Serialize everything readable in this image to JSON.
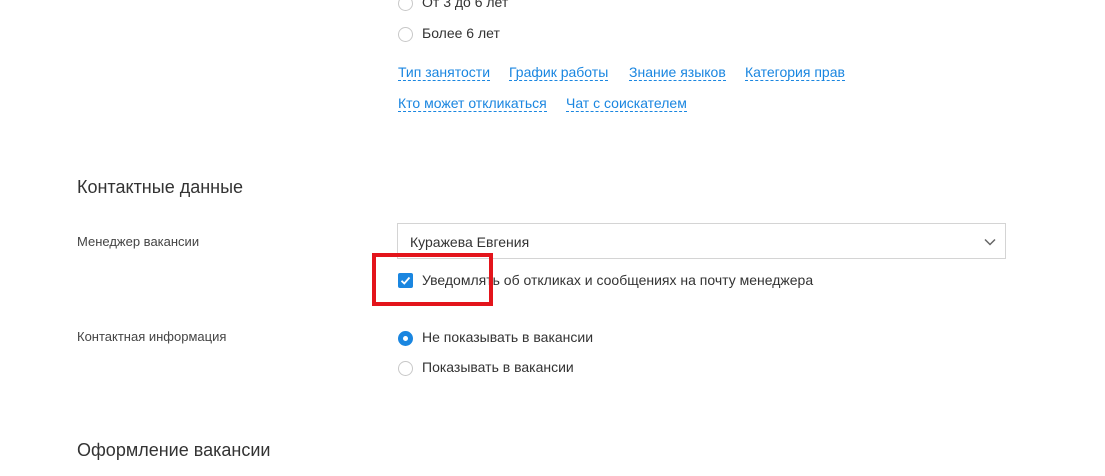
{
  "experience": {
    "options": [
      {
        "label": "От 3 до 6 лет",
        "checked": false
      },
      {
        "label": "Более 6 лет",
        "checked": false
      }
    ]
  },
  "links": {
    "row1": [
      "Тип занятости",
      "График работы",
      "Знание языков",
      "Категория прав"
    ],
    "row2": [
      "Кто может откликаться",
      "Чат с соискателем"
    ]
  },
  "contacts": {
    "title": "Контактные данные",
    "manager_label": "Менеджер вакансии",
    "manager_value": "Куражева Евгения",
    "notify_label": "Уведомлять об откликах и сообщениях на почту менеджера",
    "notify_checked": true,
    "contact_info_label": "Контактная информация",
    "contact_options": [
      {
        "label": "Не показывать в вакансии",
        "checked": true
      },
      {
        "label": "Показывать в вакансии",
        "checked": false
      }
    ]
  },
  "design": {
    "title": "Оформление вакансии"
  },
  "colors": {
    "accent": "#1a86e0",
    "highlight": "#e3141b"
  }
}
